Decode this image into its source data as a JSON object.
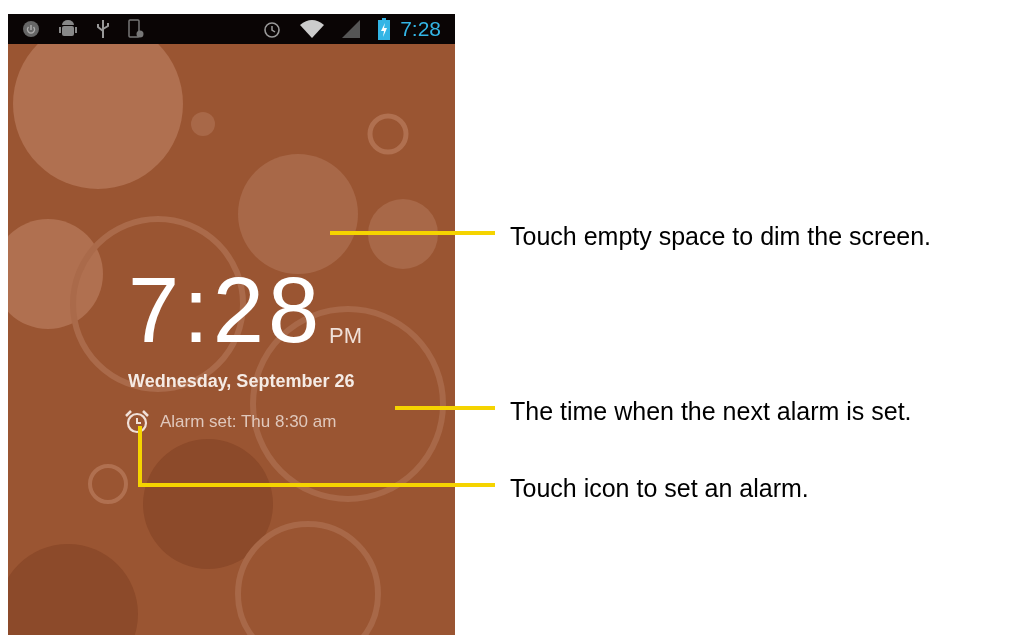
{
  "status_bar": {
    "time": "7:28"
  },
  "lock_screen": {
    "time": "7:28",
    "meridiem": "PM",
    "date": "Wednesday, September 26",
    "alarm": "Alarm set: Thu 8:30 am"
  },
  "callouts": [
    {
      "text": "Touch empty space to dim the screen."
    },
    {
      "text": "The time when the next alarm is set."
    },
    {
      "text": "Touch icon to set an alarm."
    }
  ]
}
